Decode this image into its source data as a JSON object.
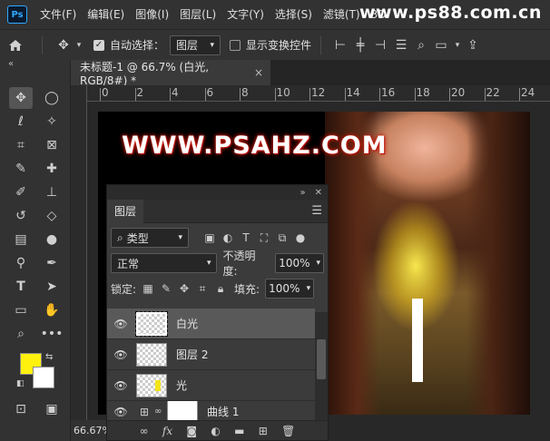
{
  "app": {
    "logo": "Ps"
  },
  "menu": [
    "文件(F)",
    "编辑(E)",
    "图像(I)",
    "图层(L)",
    "文字(Y)",
    "选择(S)",
    "滤镜(T)",
    "3D"
  ],
  "watermark": "www.ps88.com.cn",
  "options": {
    "auto_select_label": "自动选择：",
    "auto_select_checked": true,
    "auto_select_target": "图层",
    "show_transform_label": "显示变换控件",
    "show_transform_checked": false
  },
  "document": {
    "tab_title": "未标题-1 @ 66.7% (白光, RGB/8#) *",
    "close_glyph": "×",
    "zoom": "66.67%"
  },
  "ruler": {
    "labels": [
      "0",
      "2",
      "4",
      "6",
      "8",
      "10",
      "12",
      "14",
      "16",
      "18",
      "20",
      "22",
      "24"
    ]
  },
  "canvas": {
    "headline": "WWW.PSAHZ.COM"
  },
  "colors": {
    "foreground": "#fff10e",
    "background": "#ffffff",
    "accent": "#31a8ff"
  },
  "layers_panel": {
    "title": "图层",
    "filter_kind": "类型",
    "blend_mode": "正常",
    "opacity_label": "不透明度:",
    "opacity_value": "100%",
    "lock_label": "锁定:",
    "fill_label": "填充:",
    "fill_value": "100%",
    "layers": [
      {
        "name": "白光",
        "selected": true
      },
      {
        "name": "图层 2",
        "selected": false
      },
      {
        "name": "光",
        "selected": false
      },
      {
        "name": "曲线 1",
        "selected": false
      }
    ],
    "bottom_icons": [
      "link-icon",
      "fx-icon",
      "mask-icon",
      "adjustment-icon",
      "folder-icon",
      "new-layer-icon",
      "trash-icon"
    ]
  },
  "toolbar": {
    "icons": [
      "move-icon",
      "marquee-icon",
      "lasso-icon",
      "magic-wand-icon",
      "crop-icon",
      "frame-icon",
      "eyedropper-icon",
      "healing-icon",
      "brush-icon",
      "stamp-icon",
      "history-brush-icon",
      "eraser-icon",
      "gradient-icon",
      "blur-icon",
      "dodge-icon",
      "pen-icon",
      "type-icon",
      "path-select-icon",
      "rectangle-icon",
      "hand-icon",
      "zoom-icon",
      "more-icon"
    ]
  }
}
